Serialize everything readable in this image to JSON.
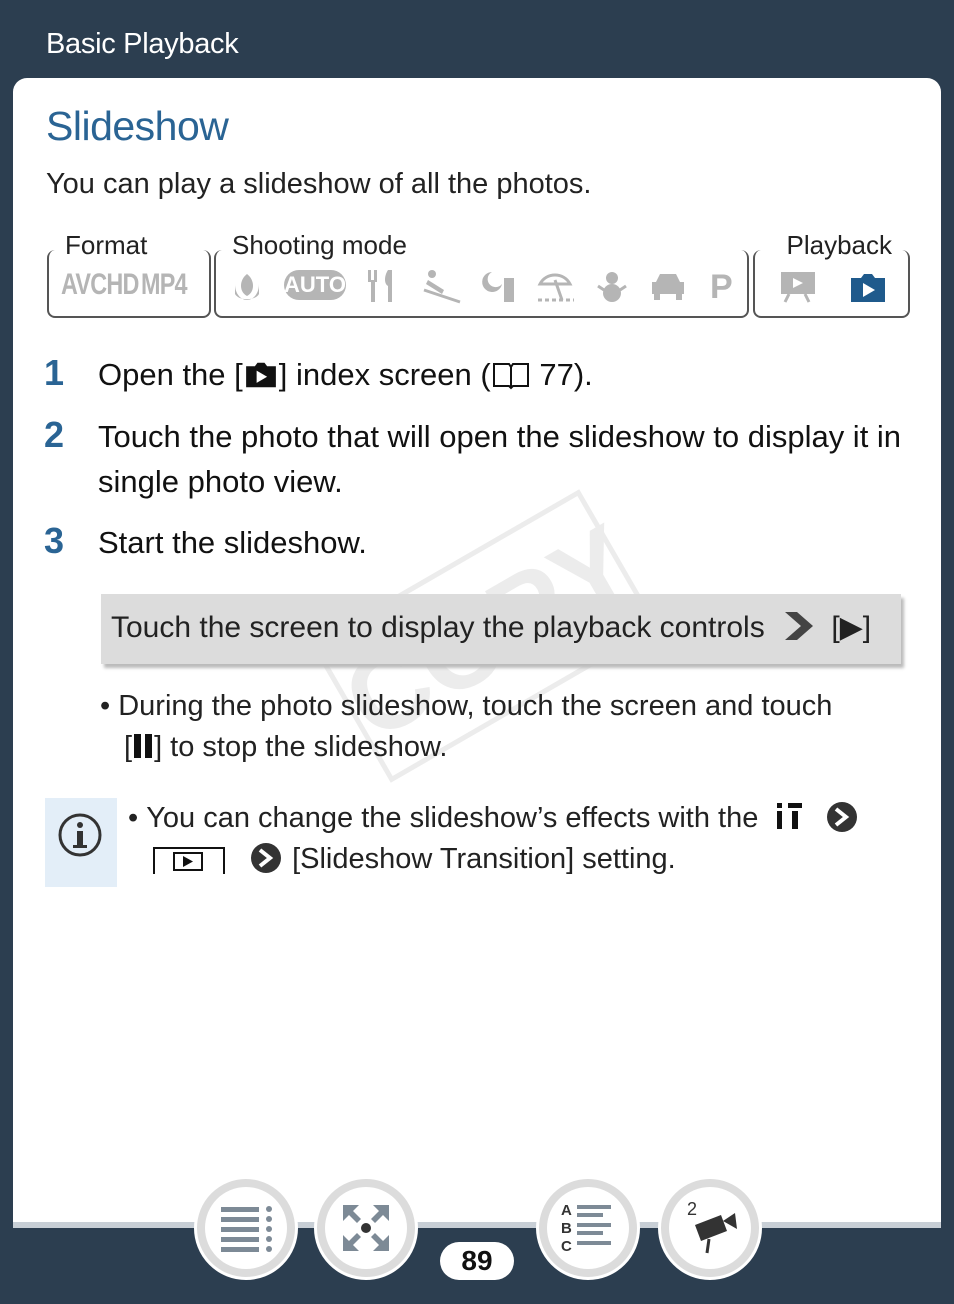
{
  "header": {
    "section_title": "Basic Playback"
  },
  "title": "Slideshow",
  "intro": "You can play a slideshow of all the photos.",
  "mode_table": {
    "format_label": "Format",
    "formats": [
      "AVCHD",
      "MP4"
    ],
    "shooting_label": "Shooting mode",
    "shooting_icons": [
      "macro-icon",
      "auto-icon",
      "food-icon",
      "skiing-icon",
      "night-icon",
      "beach-icon",
      "snow-icon",
      "car-icon",
      "program-icon"
    ],
    "auto_text": "AUTO",
    "program_text": "P",
    "playback_label": "Playback",
    "playback_icons": [
      "movie-playback-icon",
      "photo-playback-icon"
    ]
  },
  "steps": [
    {
      "number": "1",
      "text_before": "Open the [",
      "text_after": "] index screen (",
      "page_ref": " 77)."
    },
    {
      "number": "2",
      "text": "Touch the photo that will open the slideshow to display it in single photo view."
    },
    {
      "number": "3",
      "text": "Start the slideshow."
    }
  ],
  "instruction_box": {
    "text": "Touch the screen to display the playback controls",
    "button": "[▶]"
  },
  "bullet_pause": {
    "text_line1": "During the photo slideshow, touch the screen and touch",
    "text_line2_before": "[",
    "text_line2_after": "] to stop the slideshow."
  },
  "note": {
    "text_line1": "You can change the slideshow’s effects with the",
    "text_line2": "[Slideshow Transition] setting."
  },
  "watermark": "COPY",
  "page_number": "89",
  "nav": [
    "table-of-contents",
    "index",
    "alphabetical-index",
    "camera-mode"
  ],
  "nav_badge": "2",
  "colors": {
    "frame": "#2c3e50",
    "accent": "#2a6494",
    "icon_gray": "#b5b5b5",
    "active_icon": "#1f5a8c",
    "note_bg": "#e3eef8"
  }
}
